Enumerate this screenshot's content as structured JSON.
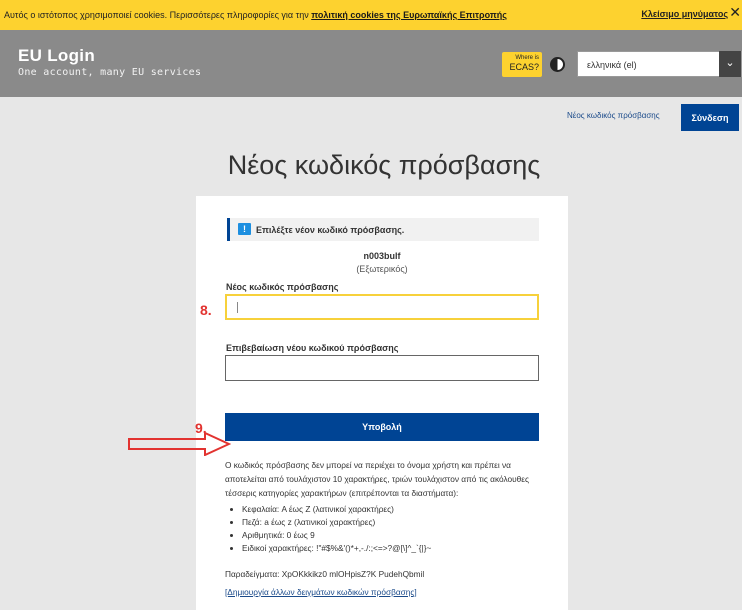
{
  "cookie_bar": {
    "message": "Αυτός ο ιστότοπος χρησιμοποιεί cookies. Περισσότερες πληροφορίες για την ",
    "policy_link": "πολιτική cookies της Ευρωπαϊκής Επιτροπής",
    "close_label": "Κλείσιμο μηνύματος",
    "close_glyph": "✕"
  },
  "header": {
    "brand": "EU Login",
    "tagline": "One account, many EU services",
    "ecas_small": "Where is",
    "ecas_big": "ECAS?",
    "language": "ελληνικά (el)",
    "caret": "⌄"
  },
  "nav": {
    "new_password_link": "Νέος κωδικός πρόσβασης",
    "login_button": "Σύνδεση"
  },
  "page_title": "Νέος κωδικός πρόσβασης",
  "form": {
    "info_icon": "!",
    "info_text": "Επιλέξτε νέον κωδικό πρόσβασης.",
    "username": "n003bulf",
    "account_type": "(Εξωτερικός)",
    "new_password_label": "Νέος κωδικός πρόσβασης",
    "new_password_value": "",
    "confirm_label": "Επιβεβαίωση νέου κωδικού πρόσβασης",
    "confirm_value": "",
    "submit_label": "Υποβολή",
    "policy_text": "Ο κωδικός πρόσβασης δεν μπορεί να περιέχει το όνομα χρήστη και πρέπει να αποτελείται από τουλάχιστον 10 χαρακτήρες, τριών τουλάχιστον από τις ακόλουθες τέσσερις κατηγορίες χαρακτήρων (επιτρέπονται τα διαστήματα):",
    "rules": [
      "Κεφαλαία: A έως Z (λατινικοί χαρακτήρες)",
      "Πεζά: a έως z (λατινικοί χαρακτήρες)",
      "Αριθμητικά: 0 έως 9",
      "Ειδικοί χαρακτήρες: !\"#$%&'()*+,-./:;<=>?@[\\]^_`{|}~"
    ],
    "examples": "Παραδείγματα: XpOKkkikz0 mlOHpisZ?K PudehQbmil",
    "generate_link": "[Δημιουργία άλλων δειγμάτων κωδικών πρόσβασης]"
  },
  "annotations": {
    "step_8": "8.",
    "step_9": "9.",
    "color": "#e23330"
  }
}
